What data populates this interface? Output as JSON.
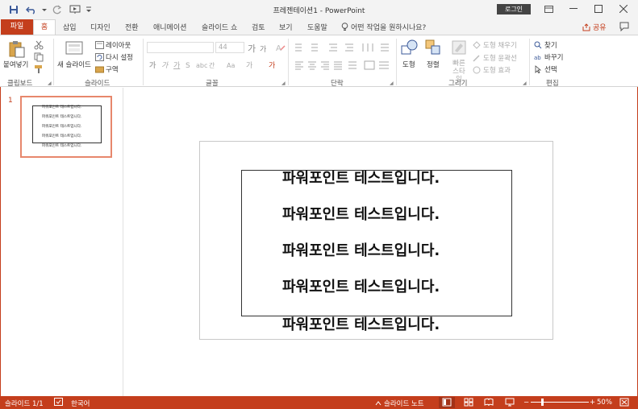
{
  "title_bar": {
    "document_title": "프레젠테이션1  -  PowerPoint",
    "login_label": "로그인"
  },
  "tabs": {
    "file": "파일",
    "home": "홈",
    "insert": "삽입",
    "design": "디자인",
    "transitions": "전환",
    "animations": "애니메이션",
    "slideshow": "슬라이드 쇼",
    "review": "검토",
    "view": "보기",
    "help": "도움말",
    "tell_me": "어떤 작업을 원하시나요?",
    "share": "공유"
  },
  "ribbon": {
    "clipboard": {
      "paste": "붙여넣기",
      "label": "클립보드"
    },
    "slides": {
      "new_slide": "새 슬라이드",
      "layout": "레이아웃",
      "reset": "다시 설정",
      "section": "구역",
      "label": "슬라이드"
    },
    "font": {
      "size": "44",
      "grow": "가",
      "shrink": "가",
      "label": "글꼴"
    },
    "paragraph": {
      "label": "단락"
    },
    "drawing": {
      "shapes": "도형",
      "arrange": "정렬",
      "quick_styles": "빠른 스타일",
      "fill": "도형 채우기",
      "outline": "도형 윤곽선",
      "effects": "도형 효과",
      "label": "그리기"
    },
    "editing": {
      "find": "찾기",
      "replace": "바꾸기",
      "select": "선택",
      "label": "편집"
    }
  },
  "thumbnails": [
    {
      "number": "1",
      "lines": [
        "파워포인트 테스트입니다.",
        "파워포인트 테스트입니다.",
        "파워포인트 테스트입니다.",
        "파워포인트 테스트입니다.",
        "파워포인트 테스트입니다."
      ]
    }
  ],
  "slide": {
    "lines": [
      "파워포인트 테스트입니다.",
      "파워포인트 테스트입니다.",
      "파워포인트 테스트입니다.",
      "파워포인트 테스트입니다.",
      "파워포인트 테스트입니다."
    ]
  },
  "status_bar": {
    "slide_count": "슬라이드 1/1",
    "language": "한국어",
    "notes": "슬라이드 노트",
    "zoom": "50%",
    "zoom_minus": "−",
    "zoom_plus": "+"
  },
  "colors": {
    "accent": "#c43e1c",
    "thumb_border": "#e7876c"
  }
}
